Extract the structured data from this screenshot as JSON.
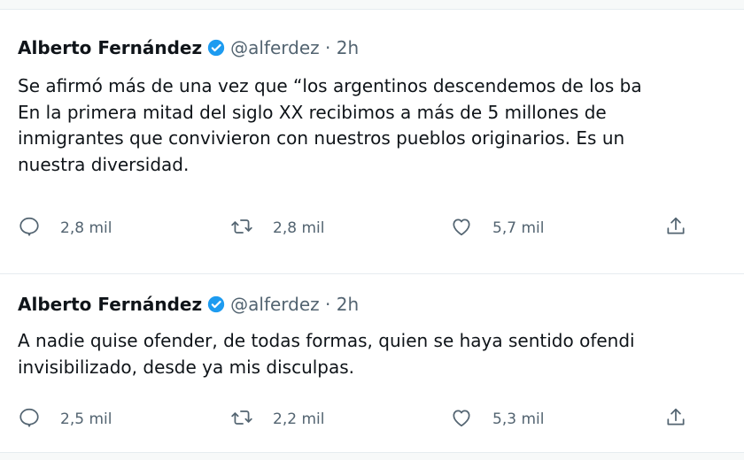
{
  "tweets": [
    {
      "author": "Alberto Fernández",
      "handle": "@alferdez",
      "separator": "·",
      "time": "2h",
      "lines": [
        "Se afirmó más de una vez que “los argentinos descendemos de los ba",
        "En la primera mitad del siglo XX recibimos a más de 5 millones de",
        "inmigrantes que convivieron con nuestros pueblos originarios. Es un",
        "nuestra diversidad."
      ],
      "replies": "2,8 mil",
      "retweets": "2,8 mil",
      "likes": "5,7 mil"
    },
    {
      "author": "Alberto Fernández",
      "handle": "@alferdez",
      "separator": "·",
      "time": "2h",
      "lines": [
        "A nadie quise ofender, de todas formas, quien se haya sentido ofendi",
        "invisibilizado, desde ya mis disculpas."
      ],
      "replies": "2,5 mil",
      "retweets": "2,2 mil",
      "likes": "5,3 mil"
    }
  ],
  "icons": {
    "verified": "verified-badge-icon",
    "reply": "reply-icon",
    "retweet": "retweet-icon",
    "like": "heart-icon",
    "share": "share-icon"
  },
  "colors": {
    "verified": "#1d9bf0",
    "text": "#0f1419",
    "secondary": "#536471",
    "background": "#f7f9f9"
  }
}
